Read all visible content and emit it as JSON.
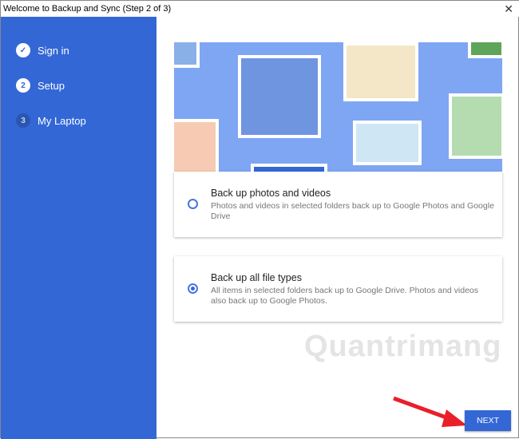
{
  "window": {
    "title": "Welcome to Backup and Sync (Step 2 of 3)",
    "close_icon": "close-icon"
  },
  "sidebar": {
    "steps": [
      {
        "number": "✓",
        "label": "Sign in",
        "state": "done"
      },
      {
        "number": "2",
        "label": "Setup",
        "state": "current"
      },
      {
        "number": "3",
        "label": "My Laptop",
        "state": "upcoming"
      }
    ]
  },
  "options": [
    {
      "title": "Back up photos and videos",
      "description": "Photos and videos in selected folders back up to Google Photos and Google Drive",
      "selected": false
    },
    {
      "title": "Back up all file types",
      "description": "All items in selected folders back up to Google Drive. Photos and videos also back up to Google Photos.",
      "selected": true
    }
  ],
  "next_label": "NEXT",
  "watermark": "Quantrimang",
  "colors": {
    "accent": "#3367d6",
    "arrow": "#e8202a"
  }
}
